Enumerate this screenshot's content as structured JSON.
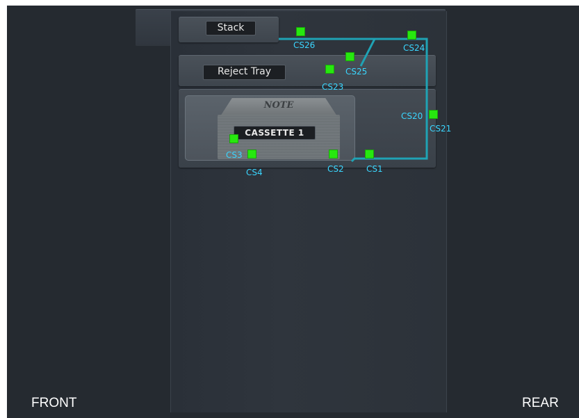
{
  "panels": {
    "stack": "Stack",
    "reject_tray": "Reject Tray",
    "cassette_note": "NOTE",
    "cassette": "CASSETTE 1"
  },
  "sides": {
    "front": "FRONT",
    "rear": "REAR"
  },
  "sensors": {
    "cs1": "CS1",
    "cs2": "CS2",
    "cs3": "CS3",
    "cs4": "CS4",
    "cs20": "CS20",
    "cs21": "CS21",
    "cs23": "CS23",
    "cs24": "CS24",
    "cs25": "CS25",
    "cs26": "CS26"
  },
  "colors": {
    "sensor": "#27e80f",
    "sensor_label": "#3ad6ff",
    "path_line": "#1fa3b5"
  }
}
